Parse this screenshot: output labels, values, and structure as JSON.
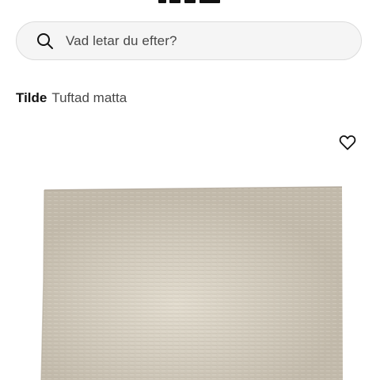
{
  "header": {
    "icons": {
      "logo": "ikea-logo-partial"
    }
  },
  "search": {
    "placeholder": "Vad letar du efter?",
    "icon": "search-icon"
  },
  "product": {
    "name": "Tilde",
    "description": "Tuftad matta",
    "favorite_icon": "heart-outline-icon",
    "image": "beige-shag-rug"
  },
  "colors": {
    "rug": "#c9c1b3",
    "search_bg": "#f5f5f5",
    "text_primary": "#111111",
    "text_secondary": "#484848"
  }
}
